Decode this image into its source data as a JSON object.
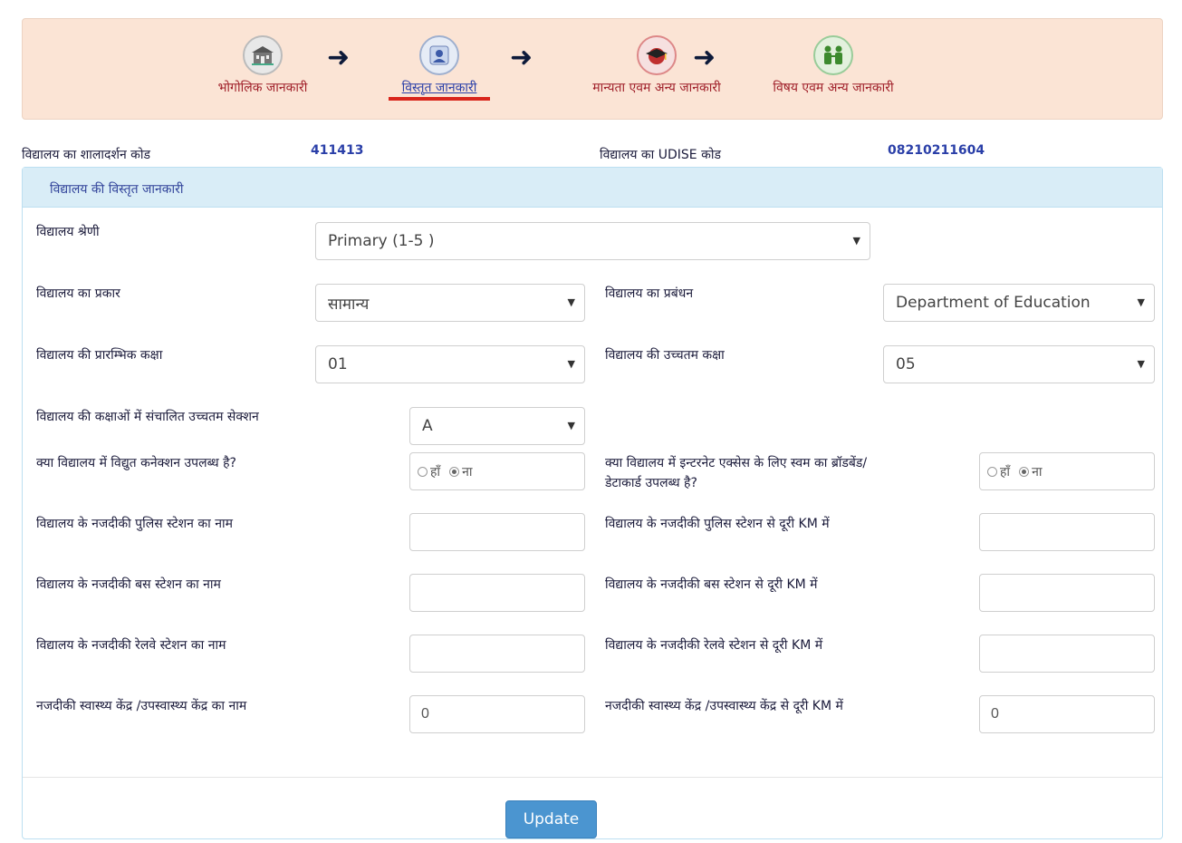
{
  "steps": [
    {
      "label": "भोगोलिक जानकारी",
      "icon": "school-building-icon",
      "color": "#a0202a"
    },
    {
      "label": "विस्तृत जानकारी",
      "icon": "user-profile-icon",
      "color": "#2a3fa8",
      "active": true
    },
    {
      "label": "मान्यता एवम अन्य जानकारी",
      "icon": "graduation-cap-icon",
      "color": "#a0202a"
    },
    {
      "label": "विषय एवम अन्य जानकारी",
      "icon": "people-icon",
      "color": "#a0202a"
    }
  ],
  "school_info": {
    "shaladarpan_label": "विद्यालय का शालादर्शन कोड",
    "shaladarpan_value": "411413",
    "udise_label": "विद्यालय का UDISE कोड",
    "udise_value": "08210211604"
  },
  "panel": {
    "heading": "विद्यालय की विस्तृत जानकारी",
    "category": {
      "label": "विद्यालय श्रेणी",
      "value": "Primary (1-5 )"
    },
    "type": {
      "label": "विद्यालय का प्रकार",
      "value": "सामान्य"
    },
    "management": {
      "label": "विद्यालय का प्रबंधन",
      "value": "Department of Education"
    },
    "lowest_class": {
      "label": "विद्यालय की प्रारम्भिक कक्षा",
      "value": "01"
    },
    "highest_class": {
      "label": "विद्यालय की उच्चतम कक्षा",
      "value": "05"
    },
    "highest_section": {
      "label": "विद्यालय की कक्षाओं में संचालित उच्चतम सेक्शन",
      "value": "A"
    },
    "electricity": {
      "label": "क्या विद्यालय में विद्युत कनेक्शन उपलब्ध है?",
      "yes": "हाँ",
      "no": "ना",
      "selected": "no"
    },
    "internet": {
      "label_line1": "क्या विद्यालय में इन्टरनेट एक्सेस के लिए स्वम का ब्रॉडबेंड/",
      "label_line2": "डेटाकार्ड उपलब्ध है?",
      "yes": "हाँ",
      "no": "ना",
      "selected": "no"
    },
    "police_name": {
      "label": "विद्यालय के नजदीकी पुलिस स्टेशन का नाम",
      "value": ""
    },
    "police_distance": {
      "label": "विद्यालय के नजदीकी पुलिस स्टेशन से दूरी KM में",
      "value": ""
    },
    "bus_name": {
      "label": "विद्यालय के नजदीकी बस स्टेशन का नाम",
      "value": ""
    },
    "bus_distance": {
      "label": "विद्यालय के नजदीकी बस स्टेशन से दूरी KM में",
      "value": ""
    },
    "rail_name": {
      "label": "विद्यालय के नजदीकी रेलवे स्टेशन का नाम",
      "value": ""
    },
    "rail_distance": {
      "label": "विद्यालय के नजदीकी रेलवे स्टेशन से दूरी KM में",
      "value": ""
    },
    "health_name": {
      "label": "नजदीकी स्वास्थ्य केंद्र /उपस्वास्थ्य केंद्र का नाम",
      "value": "0"
    },
    "health_distance": {
      "label": "नजदीकी स्वास्थ्य केंद्र /उपस्वास्थ्य केंद्र से दूरी KM में",
      "value": "0"
    },
    "update_label": "Update"
  },
  "colors": {
    "active_underline": "#d9251b",
    "accent_blue": "#4b95d0"
  }
}
